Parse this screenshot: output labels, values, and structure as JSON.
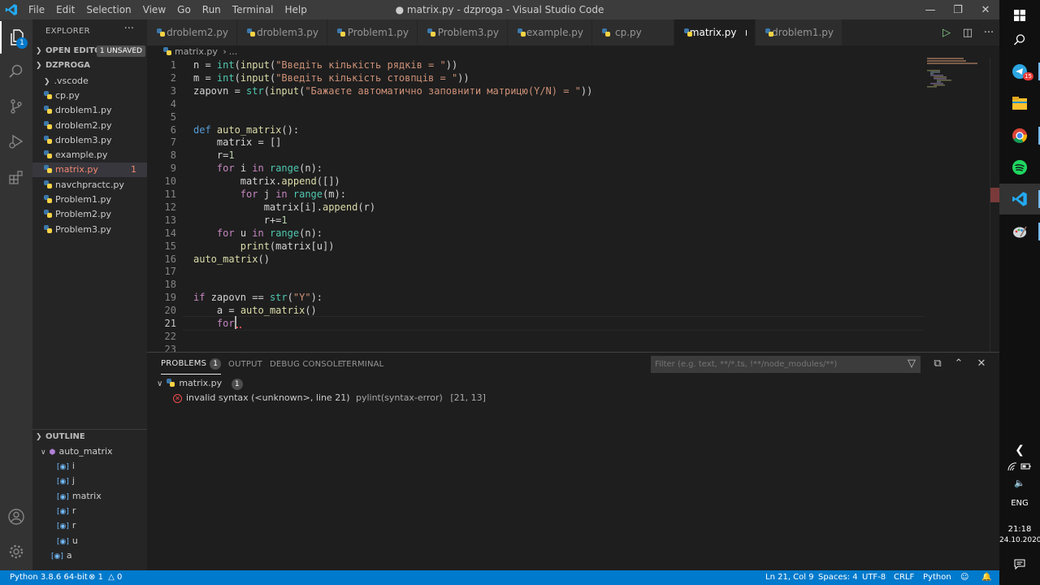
{
  "window": {
    "title": "● matrix.py - dzproga - Visual Studio Code",
    "menu": [
      "File",
      "Edit",
      "Selection",
      "View",
      "Go",
      "Run",
      "Terminal",
      "Help"
    ]
  },
  "activity": {
    "explorer_badge": "1"
  },
  "sidebar": {
    "title": "EXPLORER",
    "open_editors_label": "OPEN EDITORS",
    "unsaved_label": "1 UNSAVED",
    "folder_label": "DZPROGA",
    "files": [
      {
        "name": ".vscode",
        "folder": true
      },
      {
        "name": "cp.py"
      },
      {
        "name": "droblem1.py"
      },
      {
        "name": "droblem2.py"
      },
      {
        "name": "droblem3.py"
      },
      {
        "name": "example.py"
      },
      {
        "name": "matrix.py",
        "errors": "1"
      },
      {
        "name": "navchpractc.py"
      },
      {
        "name": "Problem1.py"
      },
      {
        "name": "Problem2.py"
      },
      {
        "name": "Problem3.py"
      }
    ],
    "outline_label": "OUTLINE",
    "outline": {
      "root": "auto_matrix",
      "children": [
        "i",
        "j",
        "matrix",
        "r",
        "r",
        "u"
      ],
      "after": [
        "a"
      ]
    }
  },
  "tabs": [
    "droblem2.py",
    "droblem3.py",
    "Problem1.py",
    "Problem3.py",
    "example.py",
    "cp.py",
    "matrix.py",
    "droblem1.py"
  ],
  "breadcrumb": {
    "file": "matrix.py",
    "sep": "›",
    "rest": "..."
  },
  "code": [
    "n = int(input(\"Введіть кількість рядків = \"))",
    "m = int(input(\"Введіть кількість стовпців = \"))",
    "zapovn = str(input(\"Бажаєте автоматично заповнити матрицю(Y/N) = \"))",
    "",
    "",
    "def auto_matrix():",
    "    matrix = []",
    "    r=1",
    "    for i in range(n):",
    "        matrix.append([])",
    "        for j in range(m):",
    "            matrix[i].append(r)",
    "            r+=1",
    "    for u in range(n):",
    "        print(matrix[u])",
    "auto_matrix()",
    "",
    "",
    "if zapovn == str(\"Y\"):",
    "    a = auto_matrix()",
    "    for ",
    "",
    ""
  ],
  "panel": {
    "tabs": {
      "problems": "PROBLEMS",
      "problems_count": "1",
      "output": "OUTPUT",
      "debug": "DEBUG CONSOLE",
      "terminal": "TERMINAL"
    },
    "filter_placeholder": "Filter (e.g. text, **/*.ts, !**/node_modules/**)",
    "file": "matrix.py",
    "file_count": "1",
    "error_message": "invalid syntax (<unknown>, line 21)",
    "error_source": "pylint(syntax-error)",
    "error_pos": "[21, 13]"
  },
  "status": {
    "interpreter": "Python 3.8.6 64-bit",
    "errors": "1",
    "warnings": "0",
    "position": "Ln 21, Col 9",
    "spaces": "Spaces: 4",
    "encoding": "UTF-8",
    "eol": "CRLF",
    "language": "Python"
  },
  "taskbar": {
    "telegram_badge": "15",
    "lang": "ENG",
    "time": "21:18",
    "date": "24.10.2020"
  },
  "colors": {
    "accent": "#007acc",
    "error": "#f14c4c",
    "string": "#ce9178",
    "keyword": "#c586c0",
    "function": "#dcdcaa",
    "builtin_type": "#4ec9b0",
    "storage": "#569cd6",
    "number": "#b5cea8",
    "variable": "#9cdcfe"
  }
}
